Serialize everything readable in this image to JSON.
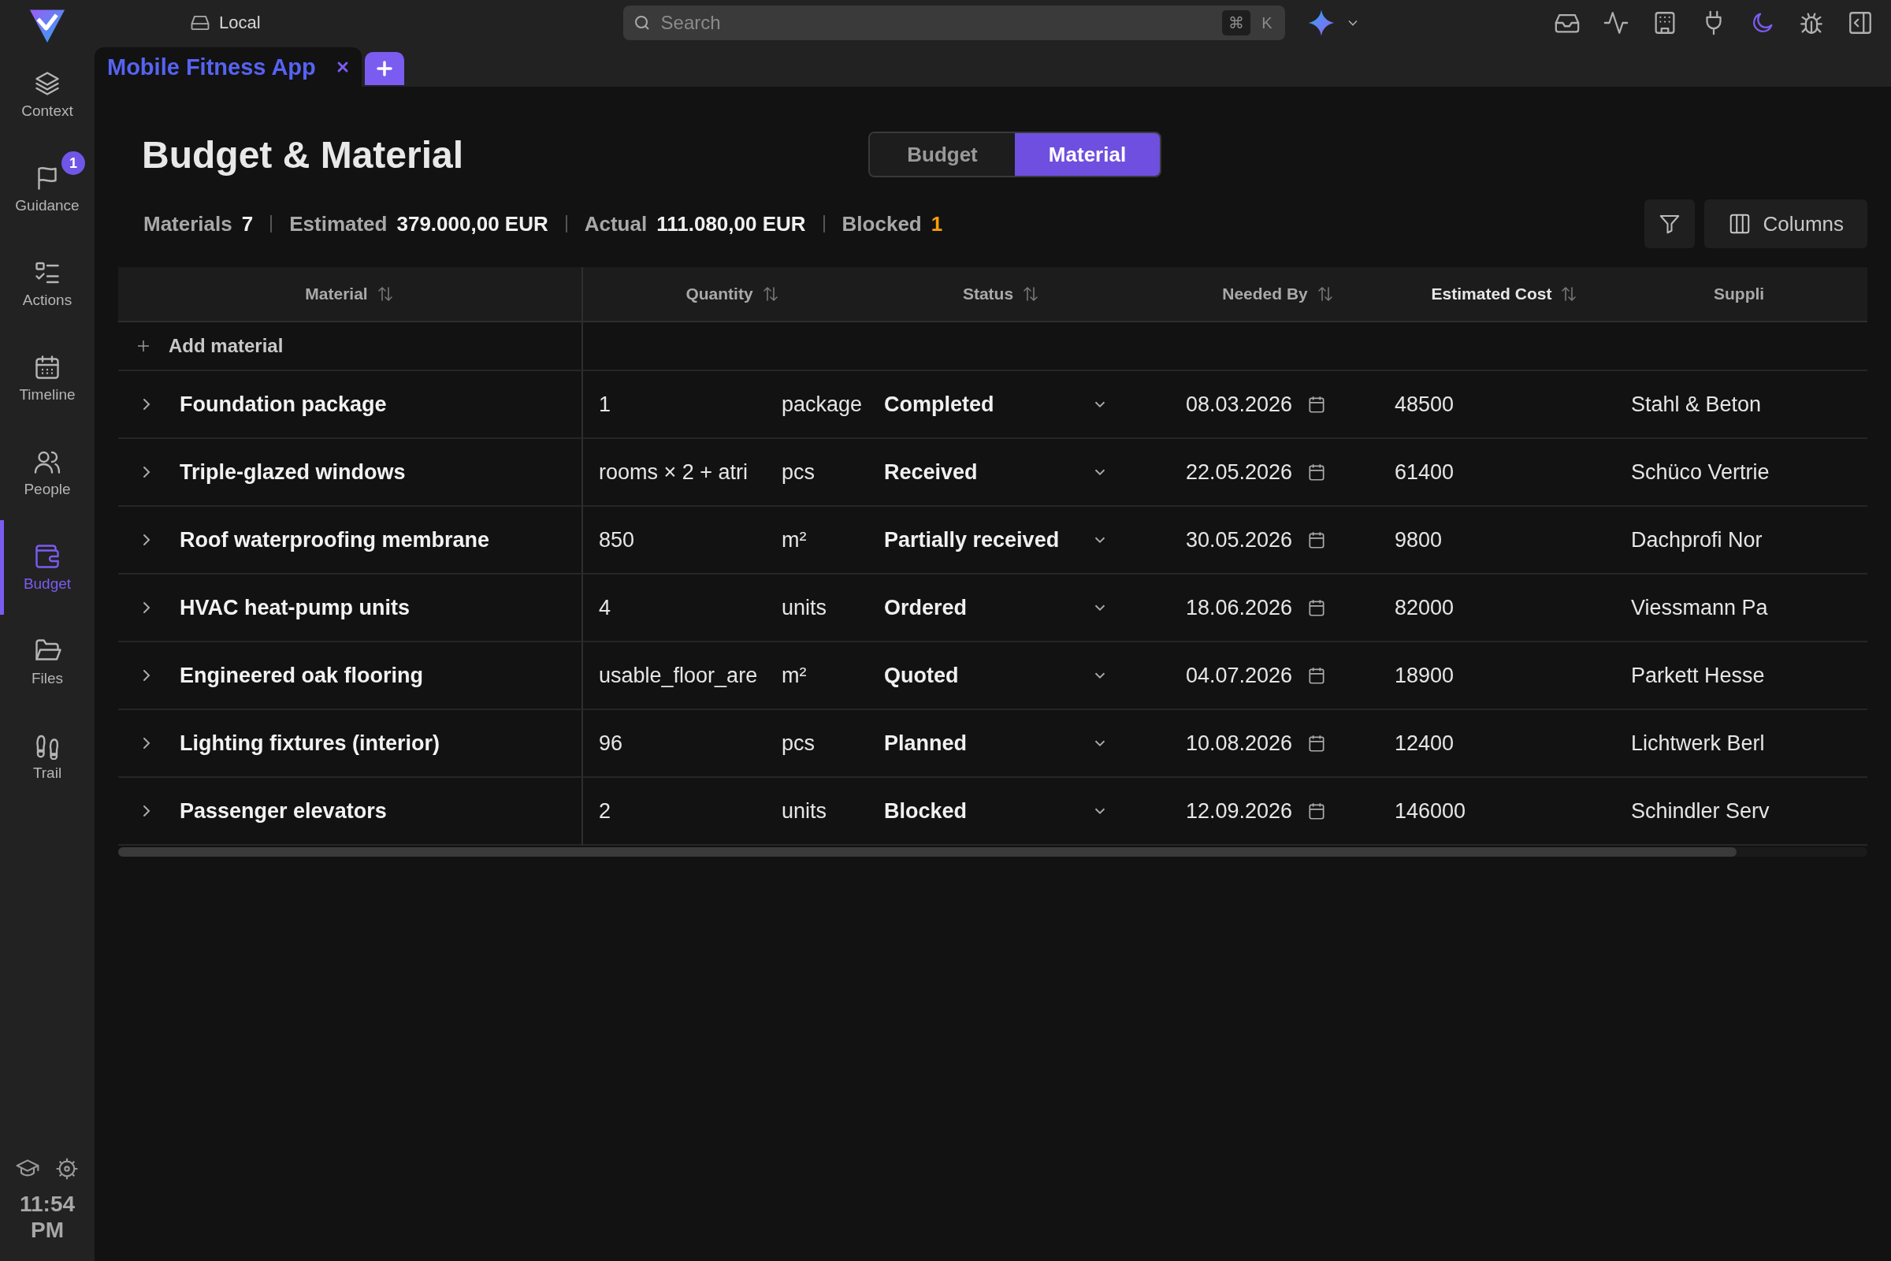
{
  "top_bar": {
    "location": "Local",
    "search": {
      "placeholder": "Search",
      "shortcut_keys": [
        "⌘",
        "K"
      ]
    }
  },
  "sidebar": {
    "items": [
      {
        "label": "Context",
        "kind": "layers",
        "selected": false
      },
      {
        "label": "Guidance",
        "kind": "flag",
        "selected": false,
        "badge": "1"
      },
      {
        "label": "Actions",
        "kind": "checklist",
        "selected": false
      },
      {
        "label": "Timeline",
        "kind": "calendar",
        "selected": false
      },
      {
        "label": "People",
        "kind": "people",
        "selected": false
      },
      {
        "label": "Budget",
        "kind": "wallet",
        "selected": true
      },
      {
        "label": "Files",
        "kind": "folder",
        "selected": false
      },
      {
        "label": "Trail",
        "kind": "footprints",
        "selected": false
      }
    ],
    "time": "11:54 PM"
  },
  "doc_tabs": [
    {
      "label": "Mobile Fitness App",
      "selected": true
    }
  ],
  "page": {
    "title": "Budget & Material",
    "view_tabs": [
      {
        "label": "Budget",
        "selected": false
      },
      {
        "label": "Material",
        "selected": true
      }
    ],
    "stats": [
      {
        "label": "Materials",
        "value": "7",
        "kind": "plain"
      },
      {
        "label": "Estimated",
        "value": "379.000,00 EUR",
        "kind": "plain"
      },
      {
        "label": "Actual",
        "value": "111.080,00 EUR",
        "kind": "plain"
      },
      {
        "label": "Blocked",
        "value": "1",
        "kind": "warning"
      }
    ],
    "columns_button": "Columns"
  },
  "table": {
    "columns": [
      "Material",
      "Quantity",
      "Status",
      "Needed By",
      "Estimated Cost",
      "Suppli"
    ],
    "add_row": "Add material",
    "rows": [
      {
        "material": "Foundation package",
        "quantity": "1",
        "unit": "package",
        "status": "Completed",
        "needed_by": "08.03.2026",
        "estimated_cost": "48500",
        "supplier": "Stahl & Beton",
        "expanded": false
      },
      {
        "material": "Triple-glazed windows",
        "quantity": "rooms × 2 + atri",
        "unit": "pcs",
        "status": "Received",
        "needed_by": "22.05.2026",
        "estimated_cost": "61400",
        "supplier": "Schüco Vertrie",
        "expanded": false
      },
      {
        "material": "Roof waterproofing membrane",
        "quantity": "850",
        "unit": "m²",
        "status": "Partially received",
        "needed_by": "30.05.2026",
        "estimated_cost": "9800",
        "supplier": "Dachprofi Nor",
        "expanded": false
      },
      {
        "material": "HVAC heat-pump units",
        "quantity": "4",
        "unit": "units",
        "status": "Ordered",
        "needed_by": "18.06.2026",
        "estimated_cost": "82000",
        "supplier": "Viessmann Pa",
        "expanded": false
      },
      {
        "material": "Engineered oak flooring",
        "quantity": "usable_floor_are",
        "unit": "m²",
        "status": "Quoted",
        "needed_by": "04.07.2026",
        "estimated_cost": "18900",
        "supplier": "Parkett Hesse",
        "expanded": false
      },
      {
        "material": "Lighting fixtures (interior)",
        "quantity": "96",
        "unit": "pcs",
        "status": "Planned",
        "needed_by": "10.08.2026",
        "estimated_cost": "12400",
        "supplier": "Lichtwerk Berl",
        "expanded": false
      },
      {
        "material": "Passenger elevators",
        "quantity": "2",
        "unit": "units",
        "status": "Blocked",
        "needed_by": "12.09.2026",
        "estimated_cost": "146000",
        "supplier": "Schindler Serv",
        "expanded": false
      }
    ]
  }
}
